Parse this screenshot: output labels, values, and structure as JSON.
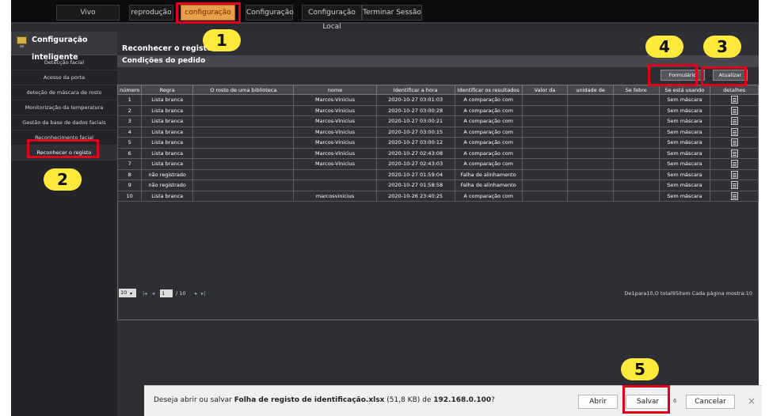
{
  "top_nav": {
    "tabs": [
      "Vivo",
      "reprodução",
      "configuração",
      "Configuração",
      "Configuração Local",
      "Terminar Sessão"
    ],
    "active_tab": "configuração"
  },
  "sidebar": {
    "header": "Configuração inteligente",
    "items": [
      "Detecção facial",
      "Acesso da porta",
      "deteção de máscara de rosto",
      "Monitorização da temperatura",
      "Gestão da base de dados faciais",
      "Reconhecimento facial",
      "Reconhecer o registo"
    ],
    "active_item": "Reconhecer o registo"
  },
  "main": {
    "title": "Reconhecer o registo",
    "conditions_label": "Condições do pedido",
    "form_button": "Formulário",
    "refresh_button": "Atualizar"
  },
  "table": {
    "headers": [
      "número",
      "Regra",
      "O rosto de uma biblioteca",
      "nome",
      "Identificar a hora",
      "Identificar os resultados",
      "Valor da",
      "unidade de",
      "Se febre",
      "Se está usando",
      "detalhes"
    ],
    "rows": [
      [
        "1",
        "Lista branca",
        "",
        "Marcos-Vinicius",
        "2020-10-27 03:01:03",
        "A comparação com",
        "",
        "",
        "",
        "Sem máscara"
      ],
      [
        "2",
        "Lista branca",
        "",
        "Marcos-Vinicius",
        "2020-10-27 03:00:28",
        "A comparação com",
        "",
        "",
        "",
        "Sem máscara"
      ],
      [
        "3",
        "Lista branca",
        "",
        "Marcos-Vinicius",
        "2020-10-27 03:00:21",
        "A comparação com",
        "",
        "",
        "",
        "Sem máscara"
      ],
      [
        "4",
        "Lista branca",
        "",
        "Marcos-Vinicius",
        "2020-10-27 03:00:15",
        "A comparação com",
        "",
        "",
        "",
        "Sem máscara"
      ],
      [
        "5",
        "Lista branca",
        "",
        "Marcos-Vinicius",
        "2020-10-27 03:00:12",
        "A comparação com",
        "",
        "",
        "",
        "Sem máscara"
      ],
      [
        "6",
        "Lista branca",
        "",
        "Marcos-Vinicius",
        "2020-10-27 02:43:08",
        "A comparação com",
        "",
        "",
        "",
        "Sem máscara"
      ],
      [
        "7",
        "Lista branca",
        "",
        "Marcos-Vinicius",
        "2020-10-27 02:43:03",
        "A comparação com",
        "",
        "",
        "",
        "Sem máscara"
      ],
      [
        "8",
        "não registrado",
        "",
        "",
        "2020-10-27 01:59:04",
        "Falha de alinhamento",
        "",
        "",
        "",
        "Sem máscara"
      ],
      [
        "9",
        "não registrado",
        "",
        "",
        "2020-10-27 01:58:58",
        "Falha de alinhamento",
        "",
        "",
        "",
        "Sem máscara"
      ],
      [
        "10",
        "Lista branca",
        "",
        "marcosvinicius",
        "2020-10-26 23:40:25",
        "A comparação com",
        "",
        "",
        "",
        "Sem máscara"
      ]
    ]
  },
  "pager": {
    "page_size": "10",
    "current_page": "1",
    "total_pages_label": "/ 10",
    "summary": "De1para10,O total95item Cada página mostra:10"
  },
  "download_bar": {
    "prefix": "Deseja abrir ou salvar ",
    "filename": "Folha de registo de identificação.xlsx",
    "size": " (51,8 KB) de ",
    "host": "192.168.0.100",
    "suffix": "?",
    "open_button": "Abrir",
    "save_button": "Salvar",
    "save_dropdown": "6",
    "cancel_button": "Cancelar",
    "close_glyph": "×"
  },
  "annotations": [
    "1",
    "2",
    "3",
    "4",
    "5"
  ],
  "colors": {
    "active_tab": "#e8a14b",
    "callout_border": "#e0001a",
    "callout_badge": "#ffe93a"
  }
}
